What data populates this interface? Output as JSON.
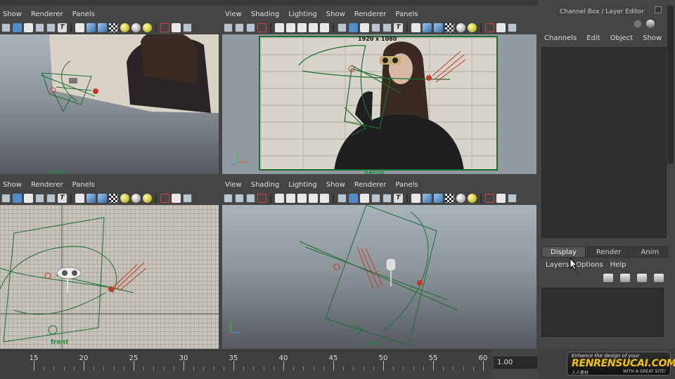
{
  "viewport_menu": [
    "View",
    "Shading",
    "Lighting",
    "Show",
    "Renderer",
    "Panels"
  ],
  "viewports": {
    "persp": {
      "label": "persp"
    },
    "camera": {
      "label": "persp",
      "resolution": "1920 x 1080"
    },
    "front": {
      "label": "front"
    },
    "side": {
      "label": "side"
    }
  },
  "channel_box": {
    "title": "Channel Box / Layer Editor",
    "menu": [
      "Channels",
      "Edit",
      "Object",
      "Show"
    ]
  },
  "layer_editor": {
    "tabs": [
      "Display",
      "Render",
      "Anim"
    ],
    "active_tab": "Display",
    "menu": [
      "Layers",
      "Options",
      "Help"
    ]
  },
  "timeline": {
    "ticks": [
      "15",
      "20",
      "25",
      "30",
      "35",
      "40",
      "45",
      "50",
      "55",
      "60"
    ],
    "current_time": "1.00"
  },
  "watermark": {
    "tagline": "Enhance the design of your",
    "brand": "RENRENSUCAI.COM",
    "chinese": "人人素材",
    "slogan": "WITH A GREAT SITE!"
  },
  "colors": {
    "ui_background": "#444444",
    "camera_green": "#1c8c3c",
    "light_red": "#c0392b"
  }
}
